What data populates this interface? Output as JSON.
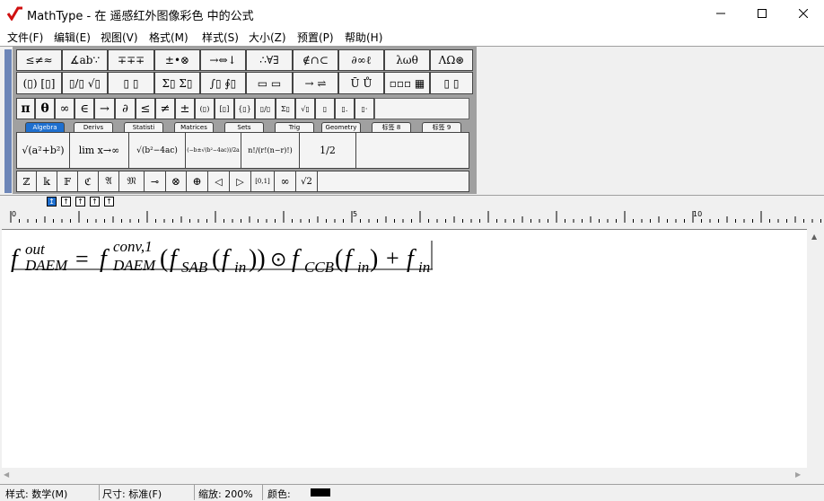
{
  "window": {
    "app_name": "MathType",
    "title": "MathType - 在 遥感红外图像彩色 中的公式"
  },
  "menu": [
    "文件(F)",
    "编辑(E)",
    "视图(V)",
    "格式(M)",
    "样式(S)",
    "大小(Z)",
    "预置(P)",
    "帮助(H)"
  ],
  "palette_row1": [
    "≤≠≈",
    "∡ab∵",
    "∓∓∓",
    "±•⊗",
    "→⇔↓",
    "∴∀∃",
    "∉∩⊂",
    "∂∞ℓ",
    "λωθ",
    "ΛΩ⊛"
  ],
  "palette_row2": [
    "(▯) [▯]",
    "▯/▯ √▯",
    "▯ ▯",
    "Σ▯ Σ▯",
    "∫▯ ∮▯",
    "▭ ▭",
    "→ ⇌",
    "Ū Ů",
    "▫▫▫ ▦",
    "▯ ▯"
  ],
  "small_row": [
    "π",
    "θ",
    "∞",
    "∈",
    "→",
    "∂",
    "≤",
    "≠",
    "±",
    "(▯)",
    "[▯]",
    "{▯}",
    "▯/▯",
    "Σ▯",
    "√▯",
    "▯",
    "▯.",
    "▯·"
  ],
  "tabs": [
    "Algebra",
    "Derivs",
    "Statisti",
    "Matrices",
    "Sets",
    "Trig",
    "Geometry",
    "标签 8",
    "标签 9"
  ],
  "active_tab": "Algebra",
  "templates": [
    "√(a²+b²)",
    "lim x→∞",
    "√(b²−4ac)",
    "(−b±√(b²−4ac))/2a",
    "n!/(r!(n−r)!)",
    "1/2"
  ],
  "bottom_row": [
    "ℤ",
    "𝕜",
    "𝔽",
    "ℭ",
    "𝔄",
    "𝔐",
    "⊸",
    "⊗",
    "⊕",
    "◁",
    "▷",
    "[0,1]",
    "∞",
    "√2"
  ],
  "ruler": {
    "labels": [
      "0",
      "5",
      "10"
    ]
  },
  "equation": {
    "lhs": "f",
    "lhs_sup": "out",
    "lhs_sub": "DAEM",
    "eq": "=",
    "f2": "f",
    "f2_sup": "conv,1",
    "f2_sub": "DAEM",
    "open1": "(",
    "f3": "f",
    "f3_sub": "SAB",
    "open2": "(",
    "f4": "f",
    "f4_sub": "in",
    "close": "))",
    "odot": "⊙",
    "f5": "f",
    "f5_sub": "CCB",
    "open3": "(",
    "f6": "f",
    "f6_sub": "in",
    "close3": ")",
    "plus": "+",
    "f7": "f",
    "f7_sub": "in"
  },
  "status": {
    "style": "样式: 数学(M)",
    "size": "尺寸: 标准(F)",
    "zoom": "缩放: 200%",
    "color": "颜色:",
    "color_value": "#000000"
  }
}
